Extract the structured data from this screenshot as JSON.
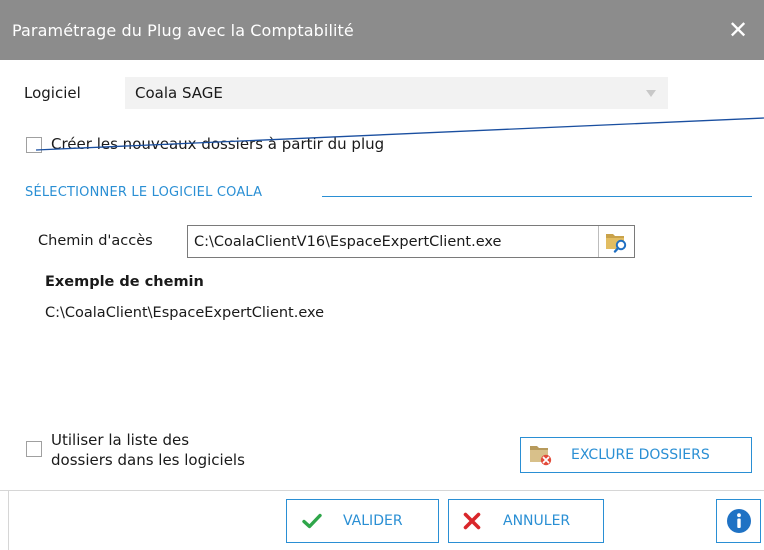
{
  "window": {
    "title": "Paramétrage du Plug avec la Comptabilité",
    "close_glyph": "✕"
  },
  "software": {
    "label": "Logiciel",
    "selected": "Coala SAGE"
  },
  "create_folders": {
    "label": "Créer les nouveaux dossiers à partir du plug",
    "checked": false
  },
  "section": {
    "title": "SÉLECTIONNER LE LOGICIEL COALA"
  },
  "path": {
    "label": "Chemin d'accès",
    "value": "C:\\CoalaClientV16\\EspaceExpertClient.exe",
    "example_title": "Exemple de chemin",
    "example_value": "C:\\CoalaClient\\EspaceExpertClient.exe"
  },
  "use_list": {
    "label_line1": "Utiliser la liste des",
    "label_line2": "dossiers dans les logiciels",
    "checked": false
  },
  "buttons": {
    "exclude": "EXCLURE DOSSIERS",
    "validate": "VALIDER",
    "cancel": "ANNULER"
  },
  "colors": {
    "titlebar": "#8c8c8c",
    "accent": "#2a8fd4",
    "validate_icon": "#2fa64a",
    "cancel_icon": "#d9262b",
    "info": "#1f72c4"
  },
  "icons": {
    "close": "close-icon",
    "dropdown": "chevron-down-icon",
    "browse": "folder-search-icon",
    "exclude": "folder-remove-icon",
    "validate": "check-icon",
    "cancel": "cross-icon",
    "info": "info-icon"
  }
}
